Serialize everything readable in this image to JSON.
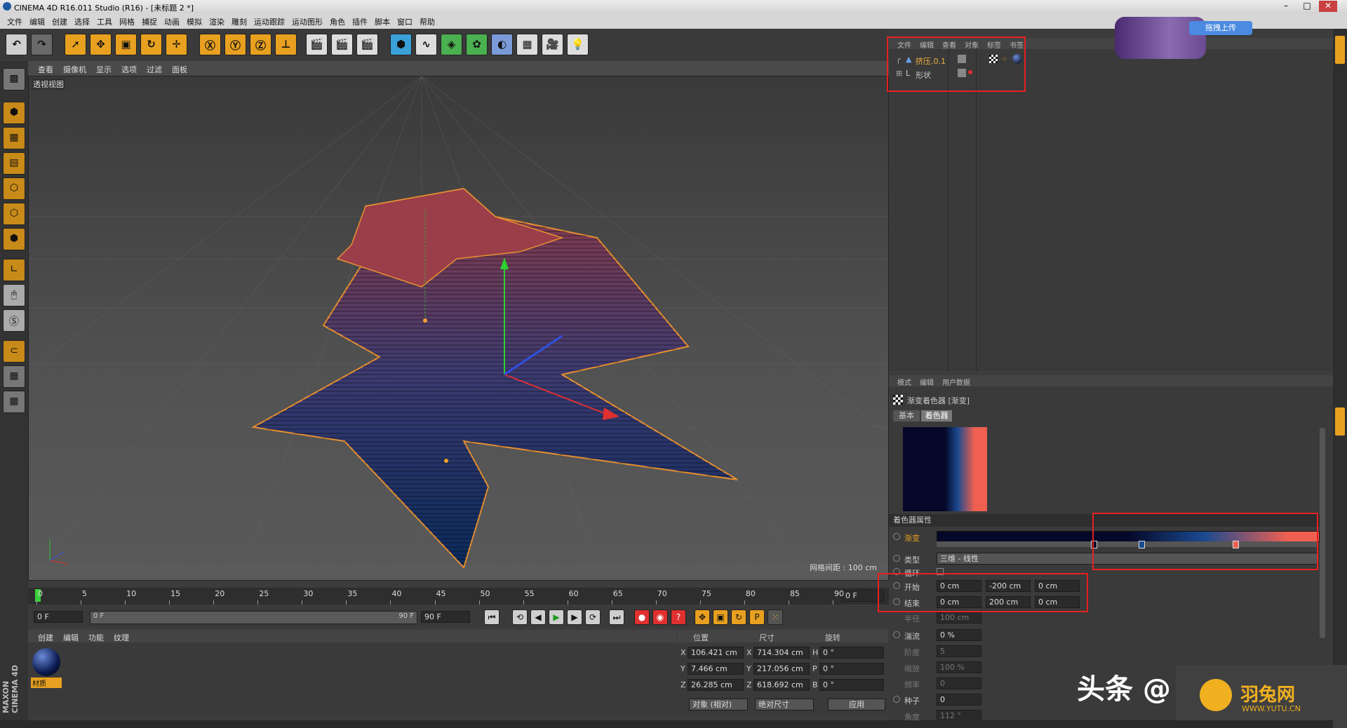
{
  "window": {
    "title": "CINEMA 4D R16.011 Studio (R16) - [未标题 2 *]"
  },
  "menu": [
    "文件",
    "编辑",
    "创建",
    "选择",
    "工具",
    "网格",
    "捕捉",
    "动画",
    "模拟",
    "渲染",
    "雕刻",
    "运动跟踪",
    "运动图形",
    "角色",
    "插件",
    "脚本",
    "窗口",
    "帮助"
  ],
  "viewport": {
    "menu": [
      "查看",
      "摄像机",
      "显示",
      "选项",
      "过滤",
      "面板"
    ],
    "label": "透视视图",
    "grid_info": "网格间距 : 100 cm"
  },
  "timeline": {
    "ticks": [
      "0",
      "5",
      "10",
      "15",
      "20",
      "25",
      "30",
      "35",
      "40",
      "45",
      "50",
      "55",
      "60",
      "65",
      "70",
      "75",
      "80",
      "85",
      "90"
    ],
    "current_frame": "0 F"
  },
  "playbar": {
    "start": "0 F",
    "range_start": "0 F",
    "range_end": "90 F",
    "end": "90 F"
  },
  "materials": {
    "menu": [
      "创建",
      "编辑",
      "功能",
      "纹理"
    ],
    "items": [
      {
        "name": "材质"
      }
    ]
  },
  "coords": {
    "headers": [
      "位置",
      "尺寸",
      "旋转"
    ],
    "rows": [
      {
        "axis": "X",
        "pos": "106.421 cm",
        "size_axis": "X",
        "size": "714.304 cm",
        "rot_axis": "H",
        "rot": "0 °"
      },
      {
        "axis": "Y",
        "pos": "7.466 cm",
        "size_axis": "Y",
        "size": "217.056 cm",
        "rot_axis": "P",
        "rot": "0 °"
      },
      {
        "axis": "Z",
        "pos": "26.285 cm",
        "size_axis": "Z",
        "size": "618.692 cm",
        "rot_axis": "B",
        "rot": "0 °"
      }
    ],
    "mode1": "对象 (相对)",
    "mode2": "绝对尺寸",
    "apply": "应用"
  },
  "objects": {
    "menu": [
      "文件",
      "编辑",
      "查看",
      "对象",
      "标签",
      "书签"
    ],
    "items": [
      {
        "name": "挤压.0.1",
        "color": "#f0b040"
      },
      {
        "name": "形状",
        "color": "#c8c8c8"
      }
    ]
  },
  "attributes": {
    "menu": [
      "模式",
      "编辑",
      "用户数据"
    ],
    "object_title": "渐变着色器 [渐变]",
    "tabs": [
      "基本",
      "着色器"
    ],
    "section": "着色器属性",
    "gradient_label": "渐变",
    "type_label": "类型",
    "type_value": "三维 - 线性",
    "cycle_label": "循环",
    "start_label": "开始",
    "start": [
      "0 cm",
      "-200 cm",
      "0 cm"
    ],
    "end_label": "结束",
    "end": [
      "0 cm",
      "200 cm",
      "0 cm"
    ],
    "radius_label": "半径",
    "radius": "100 cm",
    "turbulence_label": "湍流",
    "turbulence": "0 %",
    "octaves_label": "阶度",
    "octaves": "5",
    "scale_label": "缩放",
    "scale": "100 %",
    "frequency_label": "频率",
    "frequency": "0",
    "seed_label": "种子",
    "seed": "0",
    "angle_label": "角度",
    "angle": "112 °"
  },
  "overlay": {
    "upload": "拖拽上传",
    "watermark1": "头条 @",
    "watermark2": "羽兔网",
    "watermark3": "WWW.YUTU.CN"
  },
  "left_brand": "MAXON CINEMA 4D",
  "colors": {
    "gradient_start": "#050828",
    "gradient_mid": "#1a4a90",
    "gradient_end": "#f06050",
    "accent": "#e8a020",
    "highlight": "#e82020"
  }
}
